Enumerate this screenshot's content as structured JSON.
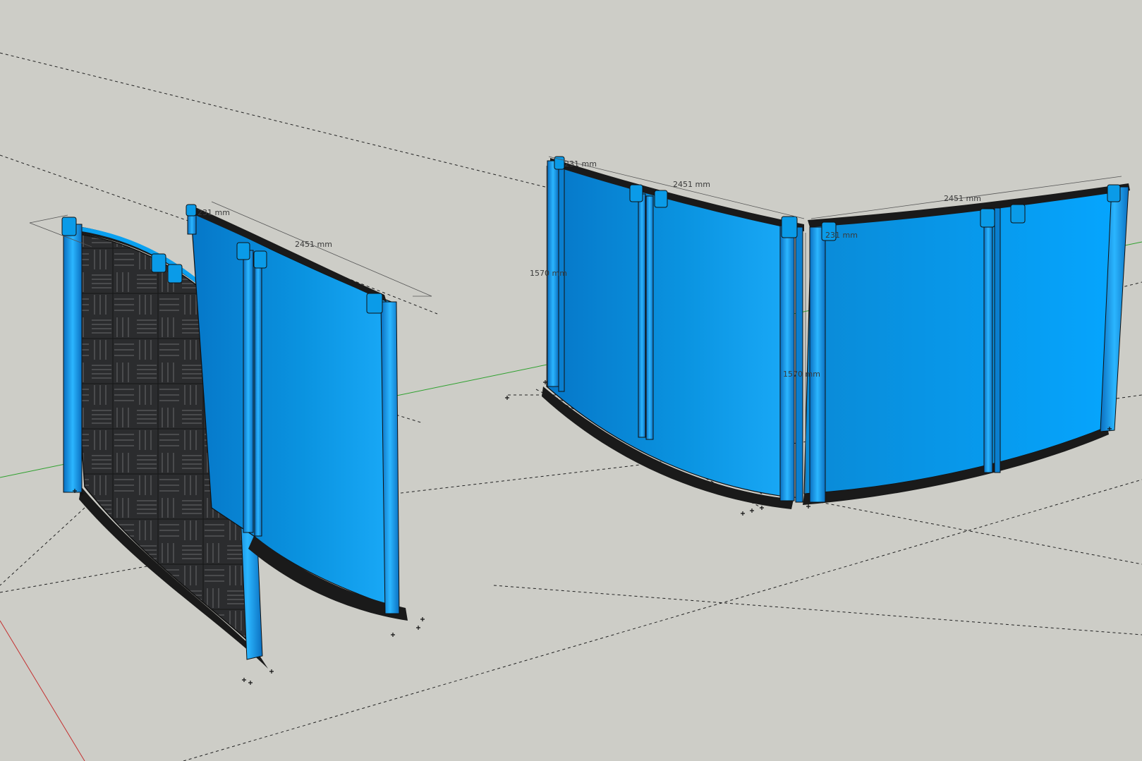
{
  "app": {
    "view": "3D model viewport"
  },
  "colors": {
    "background": "#cdcdc7",
    "panel_blue": "#0a9be8",
    "panel_blue_light": "#1fb0ff",
    "panel_blue_dark": "#0677c8",
    "frame_black": "#1a1a1a",
    "foam_dark": "#2e2f31",
    "axis_green": "#2ea12e",
    "axis_red": "#c43030"
  },
  "dimensions": {
    "left_a_width": "231 mm",
    "left_b_width": "2451 mm",
    "right_a_short": "231 mm",
    "right_a_long": "2451 mm",
    "right_height": "1570 mm",
    "right_b_long": "2451 mm",
    "right_b_short": "231 mm",
    "right_b_height": "1570 mm"
  }
}
